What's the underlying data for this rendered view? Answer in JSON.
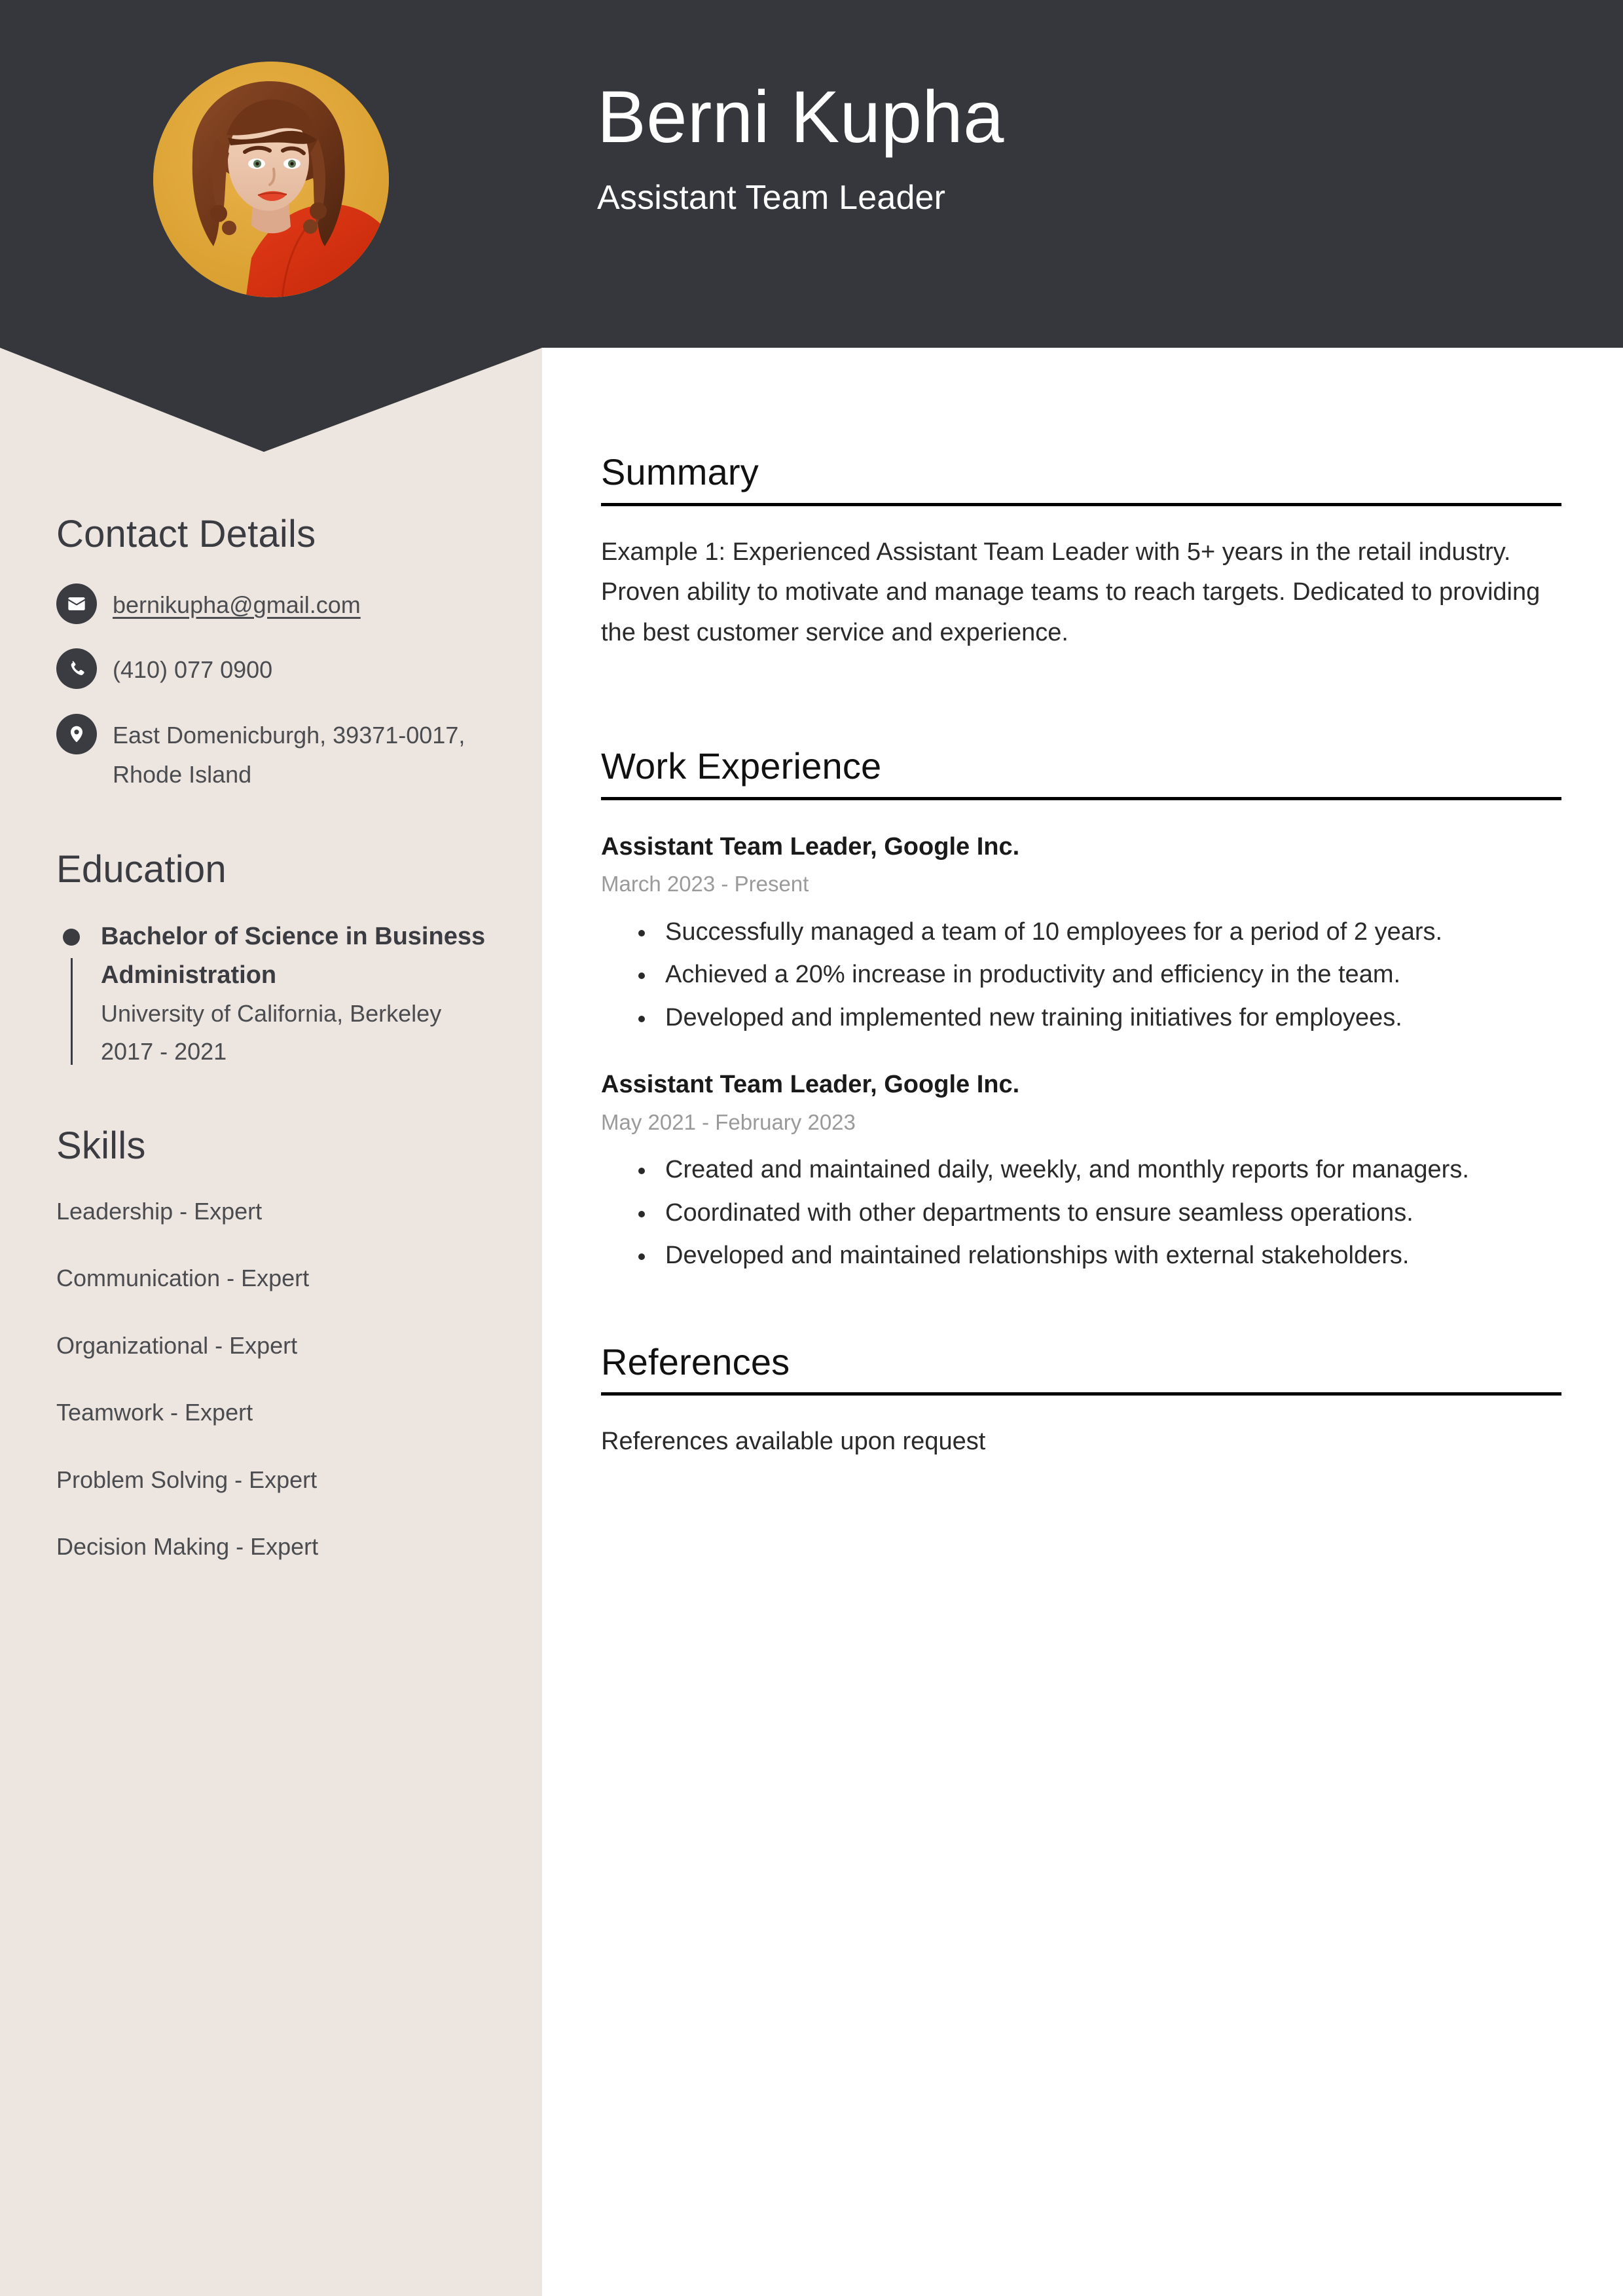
{
  "colors": {
    "header_bg": "#35373C",
    "sidebar_bg": "#EDE5E0",
    "photo_bg": "#E0A537",
    "accent_text": "#3A3C41",
    "muted_text": "#9A9A9A"
  },
  "header": {
    "name": "Berni Kupha",
    "job_title": "Assistant Team Leader",
    "photo_alt": "profile-photo"
  },
  "sidebar": {
    "contact": {
      "heading": "Contact Details",
      "items": [
        {
          "icon": "envelope-icon",
          "value": "bernikupha@gmail.com",
          "is_link": true
        },
        {
          "icon": "phone-icon",
          "value": "(410) 077 0900",
          "is_link": false
        },
        {
          "icon": "location-pin-icon",
          "value": "East Domenicburgh, 39371-0017, Rhode Island",
          "is_link": false
        }
      ]
    },
    "education": {
      "heading": "Education",
      "items": [
        {
          "degree": "Bachelor of Science in Business Administration",
          "school": "University of California, Berkeley",
          "dates": "2017 - 2021"
        }
      ]
    },
    "skills": {
      "heading": "Skills",
      "items": [
        "Leadership - Expert",
        "Communication - Expert",
        "Organizational - Expert",
        "Teamwork - Expert",
        "Problem Solving - Expert",
        "Decision Making - Expert"
      ]
    }
  },
  "main": {
    "summary": {
      "heading": "Summary",
      "text": "Example 1: Experienced Assistant Team Leader with 5+ years in the retail industry. Proven ability to motivate and manage teams to reach targets. Dedicated to providing the best customer service and experience."
    },
    "work_experience": {
      "heading": "Work Experience",
      "jobs": [
        {
          "title": "Assistant Team Leader, Google Inc.",
          "dates": "March 2023 - Present",
          "bullets": [
            "Successfully managed a team of 10 employees for a period of 2 years.",
            "Achieved a 20% increase in productivity and efficiency in the team.",
            "Developed and implemented new training initiatives for employees."
          ]
        },
        {
          "title": "Assistant Team Leader, Google Inc.",
          "dates": "May 2021 - February 2023",
          "bullets": [
            "Created and maintained daily, weekly, and monthly reports for managers.",
            "Coordinated with other departments to ensure seamless operations.",
            "Developed and maintained relationships with external stakeholders."
          ]
        }
      ]
    },
    "references": {
      "heading": "References",
      "text": "References available upon request"
    }
  }
}
